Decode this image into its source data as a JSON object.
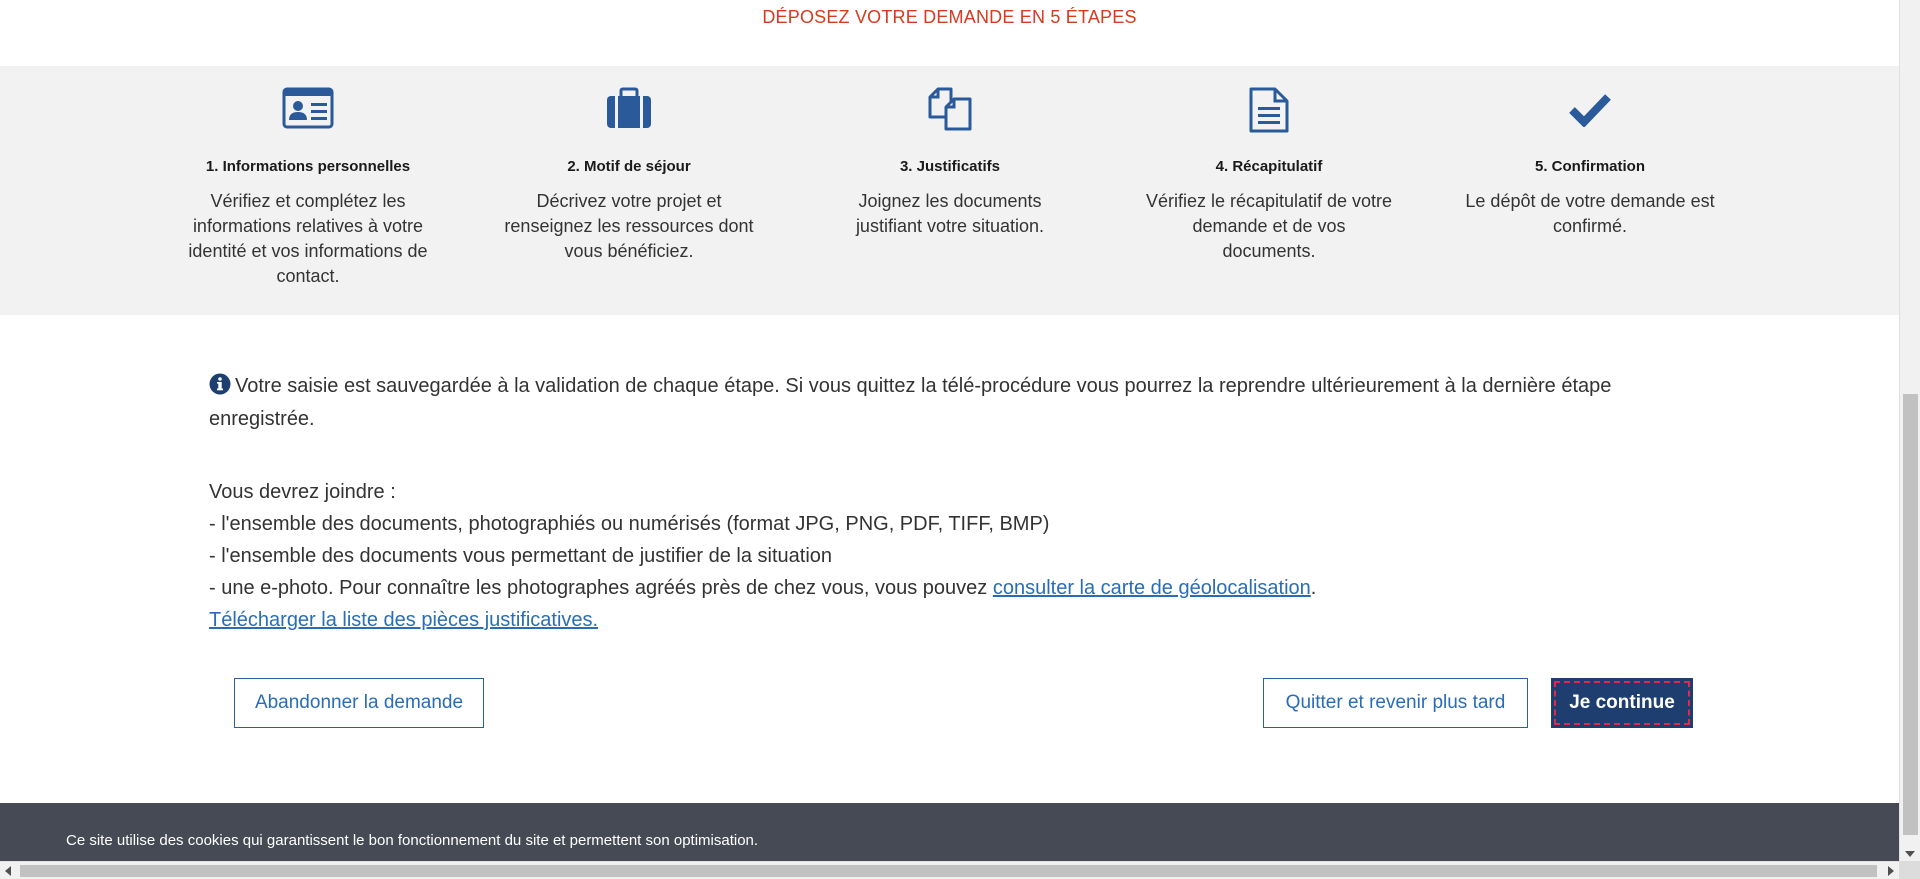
{
  "header": {
    "title": "DÉPOSEZ VOTRE DEMANDE EN 5 ÉTAPES"
  },
  "steps": [
    {
      "icon": "id-card-icon",
      "label": "1. Informations personnelles",
      "description": "Vérifiez et complétez les informations relatives à votre identité et vos informations de contact."
    },
    {
      "icon": "briefcase-icon",
      "label": "2. Motif de séjour",
      "description": "Décrivez votre projet et renseignez les ressources dont vous bénéficiez."
    },
    {
      "icon": "documents-icon",
      "label": "3. Justificatifs",
      "description": "Joignez les documents justifiant votre situation."
    },
    {
      "icon": "document-text-icon",
      "label": "4. Récapitulatif",
      "description": "Vérifiez le récapitulatif de votre demande et de vos documents."
    },
    {
      "icon": "checkmark-icon",
      "label": "5. Confirmation",
      "description": "Le dépôt de votre demande est confirmé."
    }
  ],
  "info": {
    "icon": "info-circle-icon",
    "text": "Votre saisie est sauvegardée à la validation de chaque étape. Si vous quittez la télé-procédure vous pourrez la reprendre ultérieurement à la dernière étape enregistrée."
  },
  "attachments": {
    "intro": "Vous devrez joindre :",
    "item1": "- l'ensemble des documents, photographiés ou numérisés (format JPG, PNG, PDF, TIFF, BMP)",
    "item2": "- l'ensemble des documents vous permettant de justifier de la situation",
    "item3_prefix": "- une e-photo. Pour connaître les photographes agréés près de chez vous, vous pouvez ",
    "item3_link": "consulter la carte de géolocalisation",
    "item3_suffix": ".",
    "download_link": "Télécharger la liste des pièces justificatives."
  },
  "buttons": {
    "abandon": "Abandonner la demande",
    "later": "Quitter et revenir plus tard",
    "continue": "Je continue"
  },
  "cookie": {
    "text": "Ce site utilise des cookies qui garantissent le bon fonctionnement du site et permettent son optimisation."
  },
  "colors": {
    "title_red": "#d9391f",
    "icon_blue": "#2a5a9a",
    "link_blue": "#2a6db5",
    "primary_navy": "#1d3e6e",
    "band_gray": "#f2f2f2",
    "cookie_bg": "#454a55"
  }
}
